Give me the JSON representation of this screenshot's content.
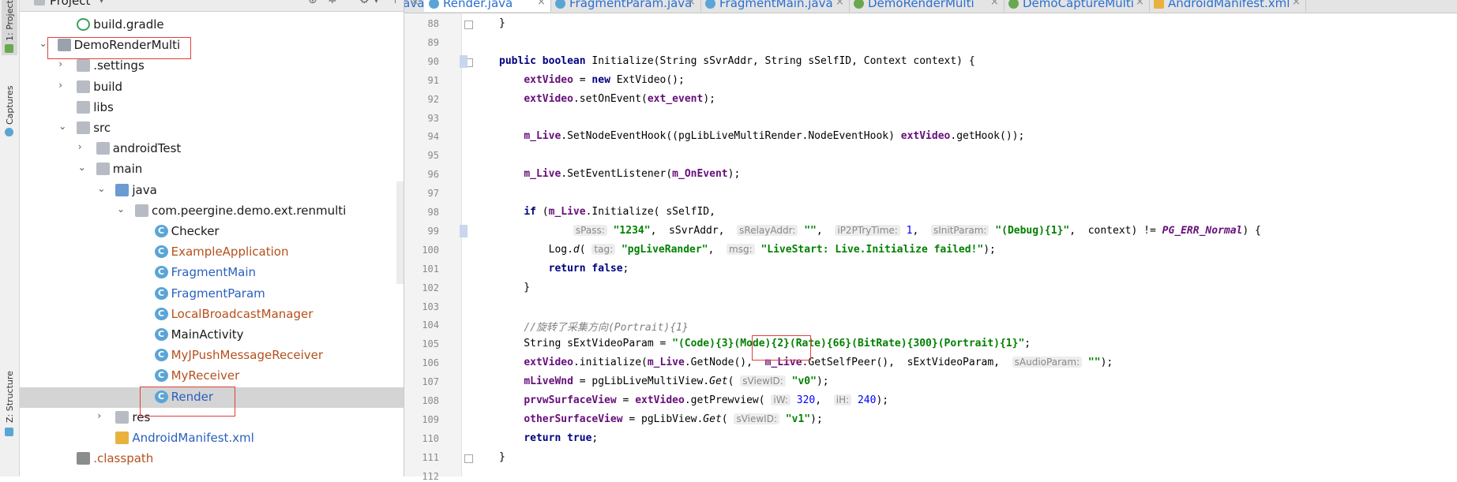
{
  "side_tabs": {
    "project": "1: Project",
    "captures": "Captures",
    "structure": "Z: Structure"
  },
  "project_panel": {
    "title": "Project",
    "tree": [
      {
        "label": "build.gradle",
        "indent": 2,
        "icon": "gradle-icon",
        "arrow": "",
        "color": "#1a1a1a"
      },
      {
        "label": "DemoRenderMulti",
        "indent": 1,
        "icon": "module-folder-icon",
        "arrow": "expanded",
        "color": "#1a1a1a"
      },
      {
        "label": ".settings",
        "indent": 2,
        "icon": "folder-icon",
        "arrow": "collapsed",
        "color": "#1a1a1a"
      },
      {
        "label": "build",
        "indent": 2,
        "icon": "folder-icon",
        "arrow": "collapsed",
        "color": "#1a1a1a"
      },
      {
        "label": "libs",
        "indent": 2,
        "icon": "folder-icon",
        "arrow": "",
        "color": "#1a1a1a"
      },
      {
        "label": "src",
        "indent": 2,
        "icon": "folder-icon",
        "arrow": "expanded",
        "color": "#1a1a1a"
      },
      {
        "label": "androidTest",
        "indent": 3,
        "icon": "folder-icon",
        "arrow": "collapsed",
        "color": "#1a1a1a"
      },
      {
        "label": "main",
        "indent": 3,
        "icon": "folder-icon",
        "arrow": "expanded",
        "color": "#1a1a1a"
      },
      {
        "label": "java",
        "indent": 4,
        "icon": "source-folder-icon",
        "arrow": "expanded",
        "color": "#1a1a1a"
      },
      {
        "label": "com.peergine.demo.ext.renmulti",
        "indent": 5,
        "icon": "package-icon",
        "arrow": "expanded",
        "color": "#1a1a1a"
      },
      {
        "label": "Checker",
        "indent": 6,
        "icon": "class-icon",
        "arrow": "",
        "color": "#1a1a1a"
      },
      {
        "label": "ExampleApplication",
        "indent": 6,
        "icon": "class-icon",
        "arrow": "",
        "color": "#b5501c"
      },
      {
        "label": "FragmentMain",
        "indent": 6,
        "icon": "class-icon",
        "arrow": "",
        "color": "#2a5fbf"
      },
      {
        "label": "FragmentParam",
        "indent": 6,
        "icon": "class-icon",
        "arrow": "",
        "color": "#2a5fbf"
      },
      {
        "label": "LocalBroadcastManager",
        "indent": 6,
        "icon": "class-icon",
        "arrow": "",
        "color": "#b5501c"
      },
      {
        "label": "MainActivity",
        "indent": 6,
        "icon": "class-icon",
        "arrow": "",
        "color": "#1a1a1a"
      },
      {
        "label": "MyJPushMessageReceiver",
        "indent": 6,
        "icon": "class-icon",
        "arrow": "",
        "color": "#b5501c"
      },
      {
        "label": "MyReceiver",
        "indent": 6,
        "icon": "class-icon",
        "arrow": "",
        "color": "#b5501c"
      },
      {
        "label": "Render",
        "indent": 6,
        "icon": "class-icon",
        "arrow": "",
        "color": "#2a5fbf",
        "selected": true
      },
      {
        "label": "res",
        "indent": 4,
        "icon": "folder-icon",
        "arrow": "collapsed",
        "color": "#1a1a1a"
      },
      {
        "label": "AndroidManifest.xml",
        "indent": 4,
        "icon": "xml-icon",
        "arrow": "",
        "color": "#2a5fbf"
      },
      {
        "label": ".classpath",
        "indent": 2,
        "icon": "file-icon",
        "arrow": "",
        "color": "#b5501c"
      }
    ]
  },
  "tabs": [
    {
      "label": "java",
      "active": false
    },
    {
      "label": "Render.java",
      "active": true
    },
    {
      "label": "FragmentParam.java",
      "active": false
    },
    {
      "label": "FragmentMain.java",
      "active": false
    },
    {
      "label": "DemoRenderMulti",
      "active": false
    },
    {
      "label": "DemoCaptureMulti",
      "active": false
    },
    {
      "label": "AndroidManifest.xml",
      "active": false
    }
  ],
  "editor": {
    "line_numbers": [
      "88",
      "89",
      "90",
      "91",
      "92",
      "93",
      "94",
      "95",
      "96",
      "97",
      "98",
      "99",
      "100",
      "101",
      "102",
      "103",
      "104",
      "105",
      "106",
      "107",
      "108",
      "109",
      "110",
      "111",
      "112"
    ],
    "lines": [
      [
        {
          "t": "}",
          "c": ""
        }
      ],
      [],
      [
        {
          "t": "public boolean ",
          "c": "kw"
        },
        {
          "t": "Initialize(String sSvrAddr, String sSelfID, Context context) {",
          "c": ""
        }
      ],
      [
        {
          "t": "    ",
          "c": ""
        },
        {
          "t": "extVideo",
          "c": "fld"
        },
        {
          "t": " = ",
          "c": ""
        },
        {
          "t": "new ",
          "c": "kw"
        },
        {
          "t": "ExtVideo();",
          "c": ""
        }
      ],
      [
        {
          "t": "    ",
          "c": ""
        },
        {
          "t": "extVideo",
          "c": "fld"
        },
        {
          "t": ".setOnEvent(",
          "c": ""
        },
        {
          "t": "ext_event",
          "c": "fld"
        },
        {
          "t": ");",
          "c": ""
        }
      ],
      [],
      [
        {
          "t": "    ",
          "c": ""
        },
        {
          "t": "m_Live",
          "c": "fld"
        },
        {
          "t": ".SetNodeEventHook((pgLibLiveMultiRender.NodeEventHook) ",
          "c": ""
        },
        {
          "t": "extVideo",
          "c": "fld"
        },
        {
          "t": ".getHook());",
          "c": ""
        }
      ],
      [],
      [
        {
          "t": "    ",
          "c": ""
        },
        {
          "t": "m_Live",
          "c": "fld"
        },
        {
          "t": ".SetEventListener(",
          "c": ""
        },
        {
          "t": "m_OnEvent",
          "c": "fld"
        },
        {
          "t": ");",
          "c": ""
        }
      ],
      [],
      [
        {
          "t": "    ",
          "c": ""
        },
        {
          "t": "if ",
          "c": "kw"
        },
        {
          "t": "(",
          "c": ""
        },
        {
          "t": "m_Live",
          "c": "fld"
        },
        {
          "t": ".Initialize( sSelfID,",
          "c": ""
        }
      ],
      [
        {
          "t": "            ",
          "c": ""
        },
        {
          "t": "sPass:",
          "c": "hint"
        },
        {
          "t": " ",
          "c": ""
        },
        {
          "t": "\"1234\"",
          "c": "str"
        },
        {
          "t": ",  sSvrAddr,  ",
          "c": ""
        },
        {
          "t": "sRelayAddr:",
          "c": "hint"
        },
        {
          "t": " ",
          "c": ""
        },
        {
          "t": "\"\"",
          "c": "str"
        },
        {
          "t": ",  ",
          "c": ""
        },
        {
          "t": "iP2PTryTime:",
          "c": "hint"
        },
        {
          "t": " ",
          "c": ""
        },
        {
          "t": "1",
          "c": "num"
        },
        {
          "t": ",  ",
          "c": ""
        },
        {
          "t": "sInitParam:",
          "c": "hint"
        },
        {
          "t": " ",
          "c": ""
        },
        {
          "t": "\"(Debug){1}\"",
          "c": "str"
        },
        {
          "t": ",  context) != ",
          "c": ""
        },
        {
          "t": "PG_ERR_Normal",
          "c": "const"
        },
        {
          "t": ") {",
          "c": ""
        }
      ],
      [
        {
          "t": "        Log.",
          "c": ""
        },
        {
          "t": "d",
          "c": "it"
        },
        {
          "t": "( ",
          "c": ""
        },
        {
          "t": "tag:",
          "c": "hint"
        },
        {
          "t": " ",
          "c": ""
        },
        {
          "t": "\"pgLiveRander\"",
          "c": "str"
        },
        {
          "t": ",  ",
          "c": ""
        },
        {
          "t": "msg:",
          "c": "hint"
        },
        {
          "t": " ",
          "c": ""
        },
        {
          "t": "\"LiveStart: Live.Initialize failed!\"",
          "c": "str"
        },
        {
          "t": ");",
          "c": ""
        }
      ],
      [
        {
          "t": "        ",
          "c": ""
        },
        {
          "t": "return false",
          "c": "kw"
        },
        {
          "t": ";",
          "c": ""
        }
      ],
      [
        {
          "t": "    }",
          "c": ""
        }
      ],
      [],
      [
        {
          "t": "    ",
          "c": ""
        },
        {
          "t": "//旋转了采集方向(Portrait){1}",
          "c": "cmt"
        }
      ],
      [
        {
          "t": "    String sExtVideoParam = ",
          "c": ""
        },
        {
          "t": "\"(Code){3}(Mode){2}(Rate){66}(BitRate){300}(Portrait){1}\"",
          "c": "str"
        },
        {
          "t": ";",
          "c": ""
        }
      ],
      [
        {
          "t": "    ",
          "c": ""
        },
        {
          "t": "extVideo",
          "c": "fld"
        },
        {
          "t": ".initialize(",
          "c": ""
        },
        {
          "t": "m_Live",
          "c": "fld"
        },
        {
          "t": ".GetNode(),  ",
          "c": ""
        },
        {
          "t": "m_Live",
          "c": "fld"
        },
        {
          "t": ".GetSelfPeer(),  sExtVideoParam,  ",
          "c": ""
        },
        {
          "t": "sAudioParam:",
          "c": "hint"
        },
        {
          "t": " ",
          "c": ""
        },
        {
          "t": "\"\"",
          "c": "str"
        },
        {
          "t": ");",
          "c": ""
        }
      ],
      [
        {
          "t": "    ",
          "c": ""
        },
        {
          "t": "mLiveWnd",
          "c": "fld"
        },
        {
          "t": " = pgLibLiveMultiView.",
          "c": ""
        },
        {
          "t": "Get",
          "c": "it"
        },
        {
          "t": "( ",
          "c": ""
        },
        {
          "t": "sViewID:",
          "c": "hint"
        },
        {
          "t": " ",
          "c": ""
        },
        {
          "t": "\"v0\"",
          "c": "str"
        },
        {
          "t": ");",
          "c": ""
        }
      ],
      [
        {
          "t": "    ",
          "c": ""
        },
        {
          "t": "prvwSurfaceView",
          "c": "fld"
        },
        {
          "t": " = ",
          "c": ""
        },
        {
          "t": "extVideo",
          "c": "fld"
        },
        {
          "t": ".getPrewview( ",
          "c": ""
        },
        {
          "t": "iW:",
          "c": "hint"
        },
        {
          "t": " ",
          "c": ""
        },
        {
          "t": "320",
          "c": "num"
        },
        {
          "t": ",  ",
          "c": ""
        },
        {
          "t": "iH:",
          "c": "hint"
        },
        {
          "t": " ",
          "c": ""
        },
        {
          "t": "240",
          "c": "num"
        },
        {
          "t": ");",
          "c": ""
        }
      ],
      [
        {
          "t": "    ",
          "c": ""
        },
        {
          "t": "otherSurfaceView",
          "c": "fld"
        },
        {
          "t": " = pgLibView.",
          "c": ""
        },
        {
          "t": "Get",
          "c": "it"
        },
        {
          "t": "( ",
          "c": ""
        },
        {
          "t": "sViewID:",
          "c": "hint"
        },
        {
          "t": " ",
          "c": ""
        },
        {
          "t": "\"v1\"",
          "c": "str"
        },
        {
          "t": ");",
          "c": ""
        }
      ],
      [
        {
          "t": "    ",
          "c": ""
        },
        {
          "t": "return true",
          "c": "kw"
        },
        {
          "t": ";",
          "c": ""
        }
      ],
      [
        {
          "t": "}",
          "c": ""
        }
      ],
      []
    ]
  },
  "colors": {
    "annotation_red": "#e0403a",
    "selection": "#d4d4d4",
    "keyword": "#000080",
    "string": "#008000",
    "field": "#660e7a"
  }
}
